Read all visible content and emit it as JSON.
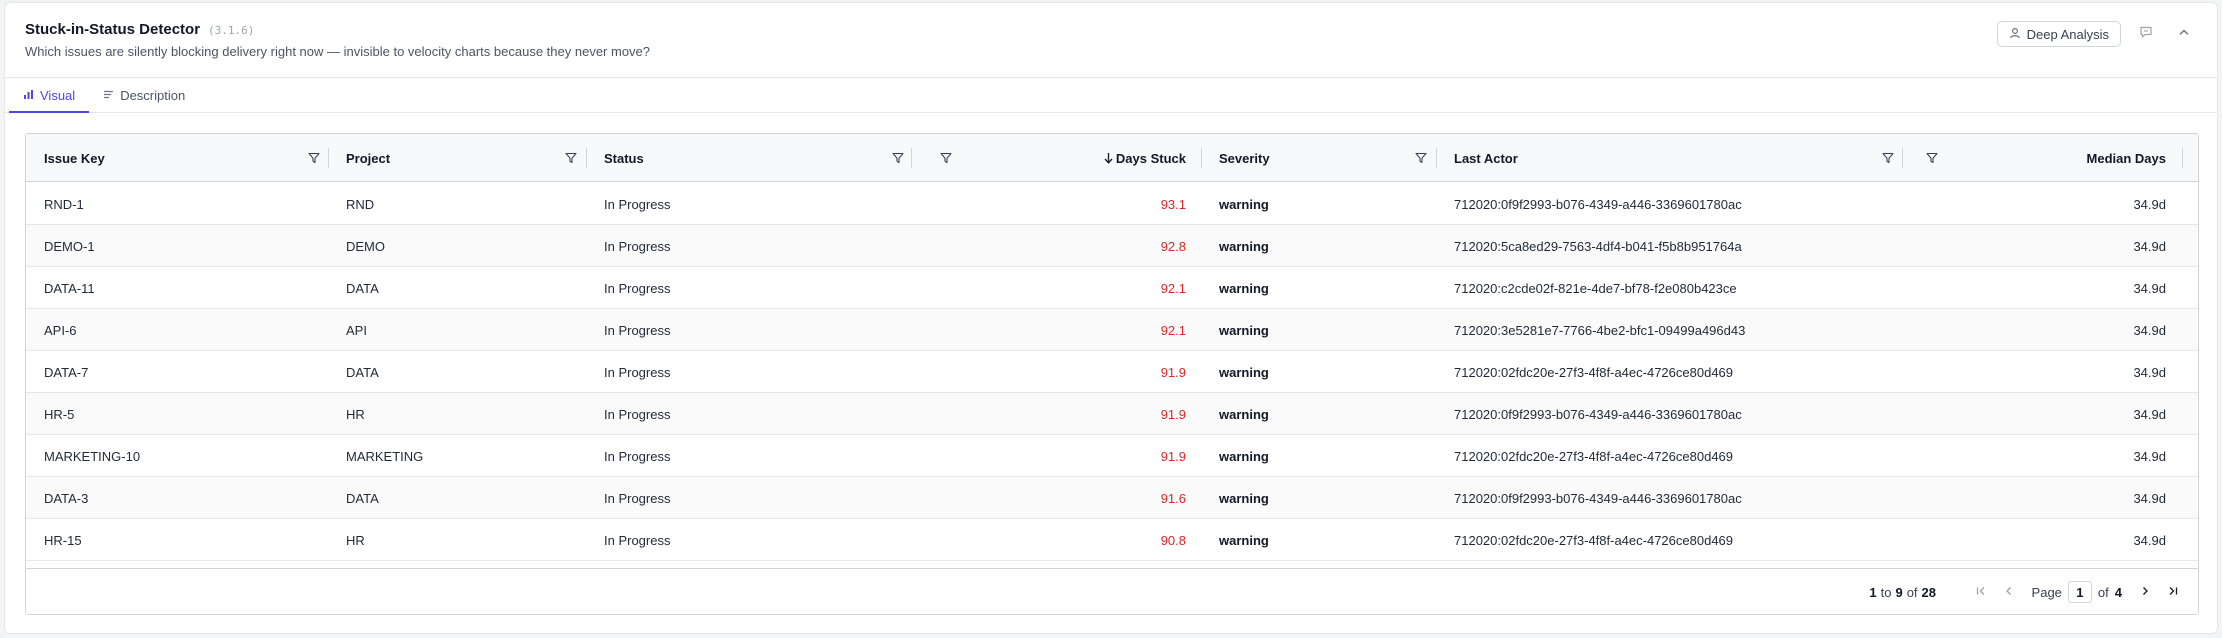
{
  "header": {
    "title": "Stuck-in-Status Detector",
    "version": "(3.1.6)",
    "subtitle": "Which issues are silently blocking delivery right now — invisible to velocity charts because they never move?",
    "deep_analysis_label": "Deep Analysis",
    "icons": [
      "user-icon",
      "comment-icon",
      "chevron-up-icon"
    ]
  },
  "tabs": [
    {
      "label": "Visual",
      "icon": "bar-chart-icon",
      "active": true
    },
    {
      "label": "Description",
      "icon": "lines-icon",
      "active": false
    }
  ],
  "table": {
    "columns": {
      "issue_key": "Issue Key",
      "project": "Project",
      "status": "Status",
      "days_stuck": "Days Stuck",
      "severity": "Severity",
      "last_actor": "Last Actor",
      "median_days": "Median Days"
    },
    "sort": {
      "column": "days_stuck",
      "direction": "descending"
    },
    "rows": [
      {
        "issue_key": "RND-1",
        "project": "RND",
        "status": "In Progress",
        "days_stuck": "93.1",
        "severity": "warning",
        "last_actor": "712020:0f9f2993-b076-4349-a446-3369601780ac",
        "median_days": "34.9d"
      },
      {
        "issue_key": "DEMO-1",
        "project": "DEMO",
        "status": "In Progress",
        "days_stuck": "92.8",
        "severity": "warning",
        "last_actor": "712020:5ca8ed29-7563-4df4-b041-f5b8b951764a",
        "median_days": "34.9d"
      },
      {
        "issue_key": "DATA-11",
        "project": "DATA",
        "status": "In Progress",
        "days_stuck": "92.1",
        "severity": "warning",
        "last_actor": "712020:c2cde02f-821e-4de7-bf78-f2e080b423ce",
        "median_days": "34.9d"
      },
      {
        "issue_key": "API-6",
        "project": "API",
        "status": "In Progress",
        "days_stuck": "92.1",
        "severity": "warning",
        "last_actor": "712020:3e5281e7-7766-4be2-bfc1-09499a496d43",
        "median_days": "34.9d"
      },
      {
        "issue_key": "DATA-7",
        "project": "DATA",
        "status": "In Progress",
        "days_stuck": "91.9",
        "severity": "warning",
        "last_actor": "712020:02fdc20e-27f3-4f8f-a4ec-4726ce80d469",
        "median_days": "34.9d"
      },
      {
        "issue_key": "HR-5",
        "project": "HR",
        "status": "In Progress",
        "days_stuck": "91.9",
        "severity": "warning",
        "last_actor": "712020:0f9f2993-b076-4349-a446-3369601780ac",
        "median_days": "34.9d"
      },
      {
        "issue_key": "MARKETING-10",
        "project": "MARKETING",
        "status": "In Progress",
        "days_stuck": "91.9",
        "severity": "warning",
        "last_actor": "712020:02fdc20e-27f3-4f8f-a4ec-4726ce80d469",
        "median_days": "34.9d"
      },
      {
        "issue_key": "DATA-3",
        "project": "DATA",
        "status": "In Progress",
        "days_stuck": "91.6",
        "severity": "warning",
        "last_actor": "712020:0f9f2993-b076-4349-a446-3369601780ac",
        "median_days": "34.9d"
      },
      {
        "issue_key": "HR-15",
        "project": "HR",
        "status": "In Progress",
        "days_stuck": "90.8",
        "severity": "warning",
        "last_actor": "712020:02fdc20e-27f3-4f8f-a4ec-4726ce80d469",
        "median_days": "34.9d"
      }
    ]
  },
  "pagination": {
    "from": "1",
    "to_word": "to",
    "to": "9",
    "of_word": "of",
    "total": "28",
    "page_label": "Page",
    "current_page": "1",
    "of_pages_word": "of",
    "total_pages": "4"
  },
  "colors": {
    "accent": "#4f46e5",
    "days_stuck_value": "#dc2626",
    "header_bg": "#f8f9fa",
    "border": "#d1d5db"
  }
}
